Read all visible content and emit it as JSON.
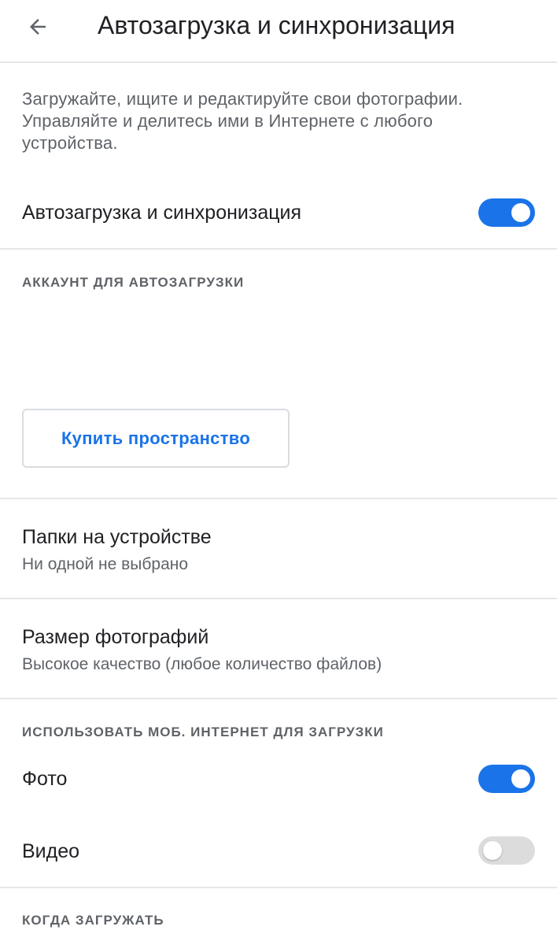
{
  "header": {
    "title": "Автозагрузка и синхронизация",
    "back_icon": "arrow-back-icon"
  },
  "description": "Загружайте, ищите и редактируйте свои фотографии. Управляйте и делитесь ими в Интернете с любого устройства.",
  "backup_sync": {
    "label": "Автозагрузка и синхронизация",
    "enabled": true
  },
  "account_section": {
    "header": "АККАУНТ ДЛЯ АВТОЗАГРУЗКИ",
    "buy_storage_label": "Купить пространство"
  },
  "device_folders": {
    "title": "Папки на устройстве",
    "subtitle": "Ни одной не выбрано"
  },
  "photo_size": {
    "title": "Размер фотографий",
    "subtitle": "Высокое качество (любое количество файлов)"
  },
  "mobile_data_section": {
    "header": "ИСПОЛЬЗОВАТЬ МОБ. ИНТЕРНЕТ ДЛЯ ЗАГРУЗКИ",
    "photo": {
      "label": "Фото",
      "enabled": true
    },
    "video": {
      "label": "Видео",
      "enabled": false
    }
  },
  "when_section": {
    "header": "КОГДА ЗАГРУЖАТЬ"
  },
  "colors": {
    "accent": "#1a73e8",
    "toggle_off": "#dcdcdc",
    "text_primary": "#202124",
    "text_secondary": "#5f6368",
    "divider": "#e6e6e6"
  }
}
